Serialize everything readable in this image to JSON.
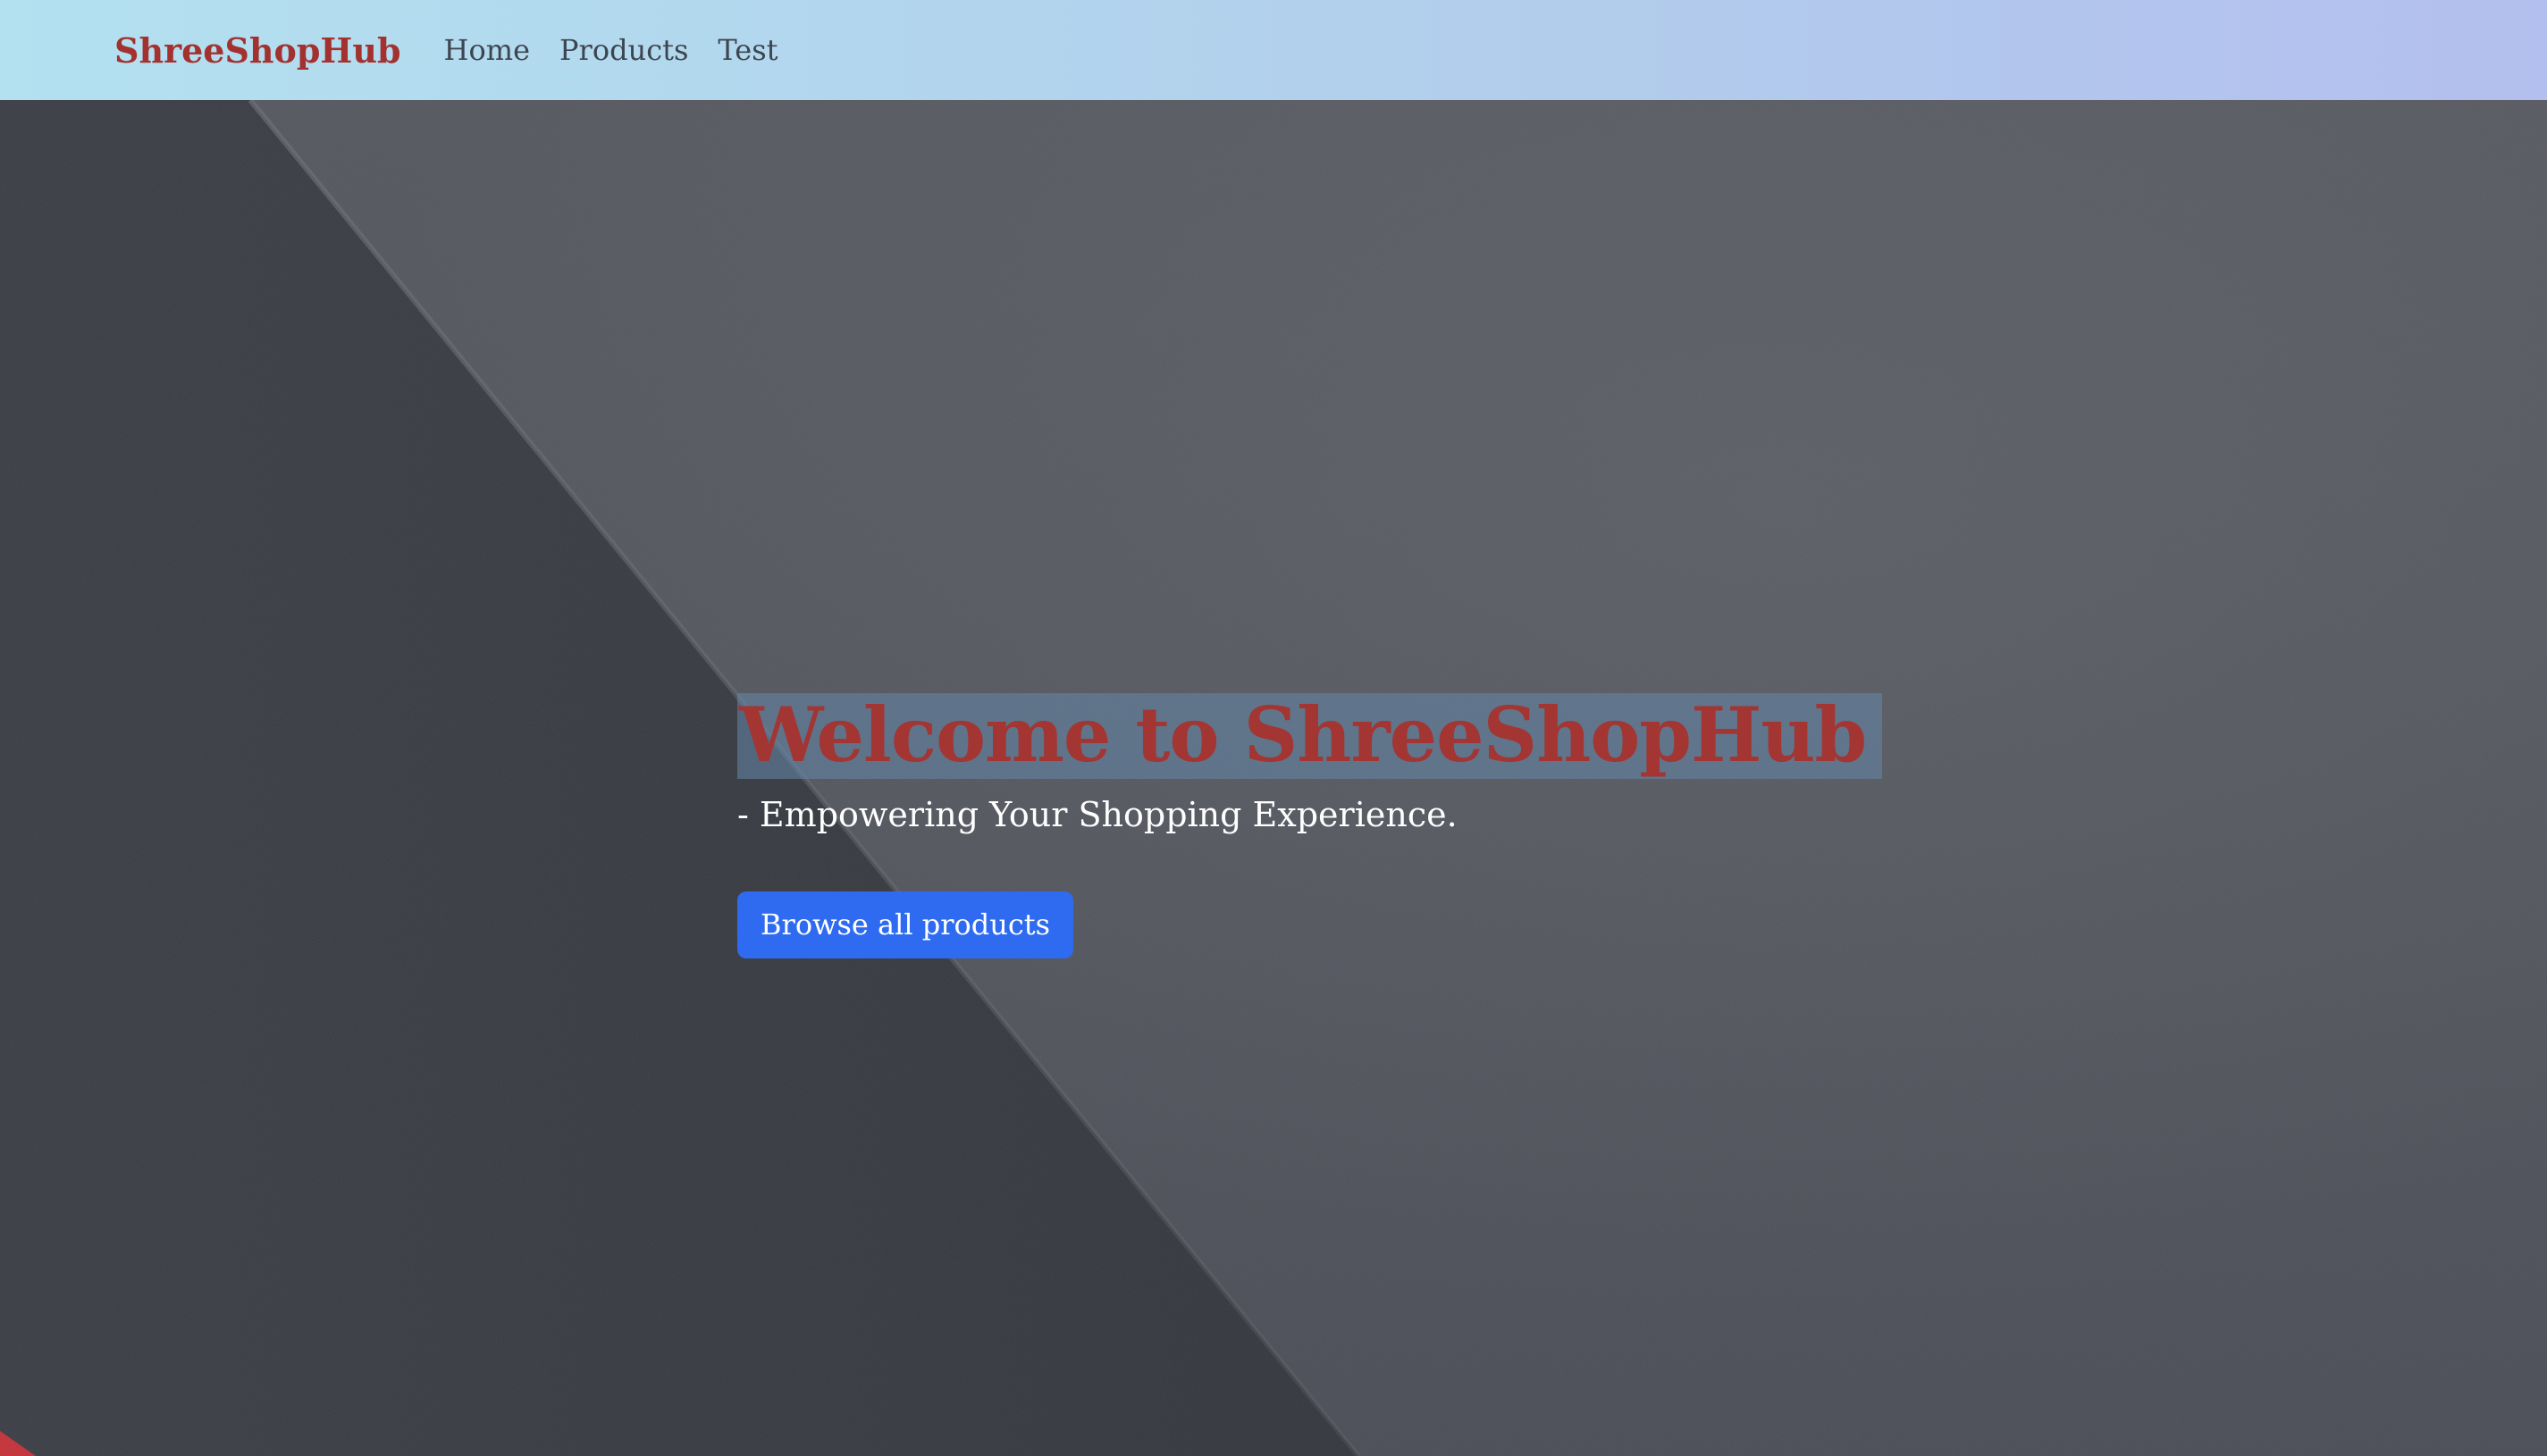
{
  "navbar": {
    "brand": "ShreeShopHub",
    "links": [
      {
        "label": "Home"
      },
      {
        "label": "Products"
      },
      {
        "label": "Test"
      }
    ]
  },
  "hero": {
    "title": "Welcome to ShreeShopHub",
    "subtitle": "- Empowering Your Shopping Experience.",
    "cta_label": "Browse all products"
  },
  "colors": {
    "brand": "#a3312f",
    "nav_text": "#3d4550",
    "cta_background": "#2f6bf0",
    "navbar_gradient_start": "#b3e1f0",
    "navbar_gradient_end": "#b3bfee"
  }
}
